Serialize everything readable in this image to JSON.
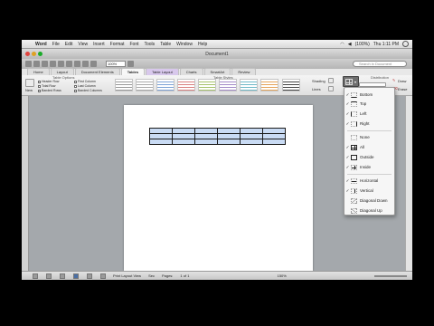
{
  "menubar": {
    "app": "Word",
    "items": [
      "File",
      "Edit",
      "View",
      "Insert",
      "Format",
      "Font",
      "Tools",
      "Table",
      "Window",
      "Help"
    ],
    "battery": "(100%)",
    "clock": "Thu 1:11 PM"
  },
  "window": {
    "title": "Document1"
  },
  "toolbar": {
    "zoom": "100%",
    "search_placeholder": "Search in Document"
  },
  "ribbon": {
    "tabs": [
      "Home",
      "Layout",
      "Document Elements",
      "Tables",
      "Table Layout",
      "Charts",
      "SmartArt",
      "Review"
    ],
    "group_options": "Table Options",
    "group_styles": "Table Styles",
    "group_draw": "Draw Borders",
    "options": [
      "Header Row",
      "Total Row",
      "Banded Rows",
      "First Column",
      "Last Column",
      "Banded Columns"
    ],
    "new_label": "New",
    "shading_label": "Shading",
    "lines_label": "Lines",
    "distribution_label": "Distribution",
    "draw_label": "Draw",
    "erase_label": "Erase"
  },
  "borders_menu": [
    {
      "label": "Bottom",
      "checked": true,
      "icon": "border-bottom-icon"
    },
    {
      "label": "Top",
      "checked": true,
      "icon": "border-top-icon"
    },
    {
      "label": "Left",
      "checked": true,
      "icon": "border-left-icon"
    },
    {
      "label": "Right",
      "checked": true,
      "icon": "border-right-icon"
    },
    {
      "label": "None",
      "checked": false,
      "icon": "border-none-icon"
    },
    {
      "label": "All",
      "checked": true,
      "icon": "border-all-icon"
    },
    {
      "label": "Outside",
      "checked": true,
      "icon": "border-outside-icon"
    },
    {
      "label": "Inside",
      "checked": true,
      "icon": "border-inside-icon"
    },
    {
      "label": "Horizontal",
      "checked": true,
      "icon": "border-horizontal-icon"
    },
    {
      "label": "Vertical",
      "checked": true,
      "icon": "border-vertical-icon"
    },
    {
      "label": "Diagonal Down",
      "checked": false,
      "icon": "border-diagonal-down-icon"
    },
    {
      "label": "Diagonal Up",
      "checked": false,
      "icon": "border-diagonal-up-icon"
    }
  ],
  "status": {
    "view_mode": "Print Layout View",
    "sec": "Sec",
    "pages": "Pages:",
    "page_count": "1 of 1",
    "zoom": "150%"
  },
  "colors": {
    "accent": "#4a6fa5",
    "table_fill": "#c9dbf4",
    "table_layout_tab": "#d8c8ec"
  }
}
